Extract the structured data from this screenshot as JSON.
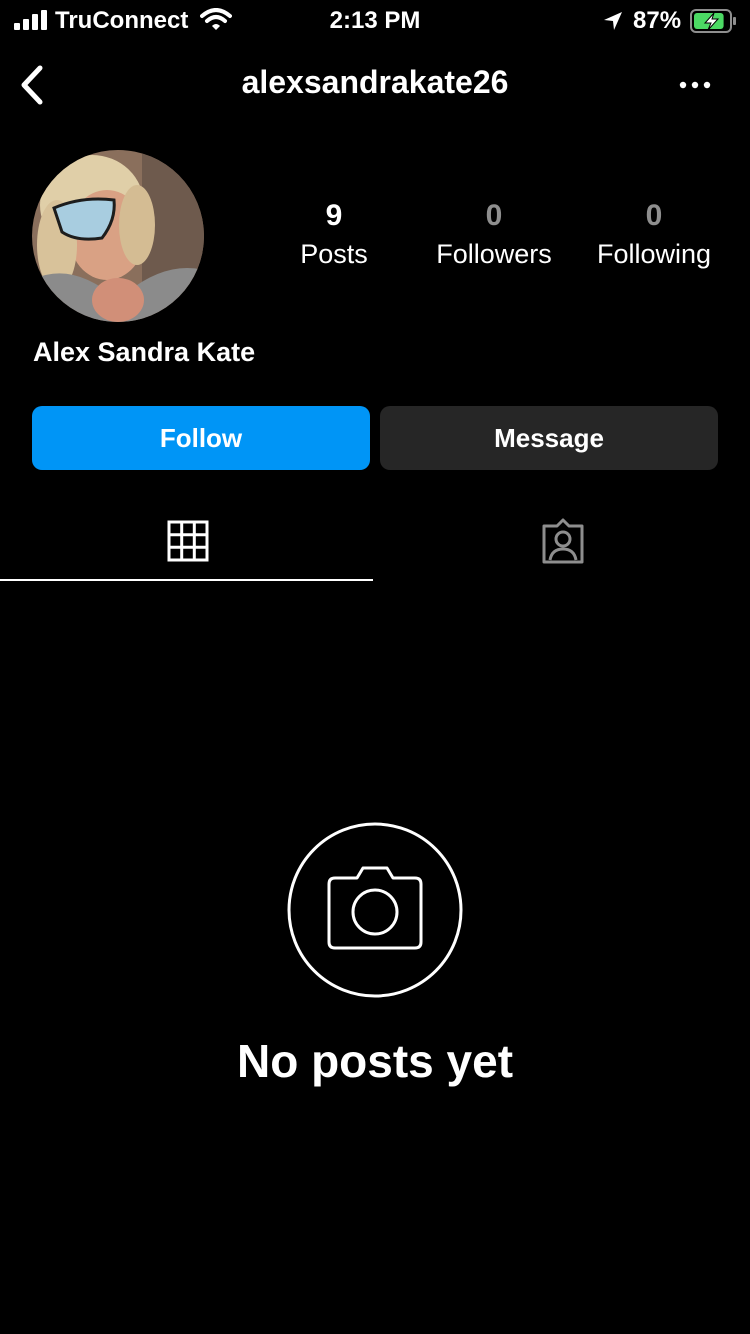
{
  "status_bar": {
    "carrier": "TruConnect",
    "time": "2:13 PM",
    "battery_percent": "87%",
    "battery_level": 0.87,
    "icons": [
      "signal-icon",
      "wifi-icon",
      "location-arrow-icon",
      "battery-charging-icon"
    ]
  },
  "header": {
    "username": "alexsandrakate26",
    "icons": [
      "back-chevron-icon",
      "more-options-icon"
    ]
  },
  "profile": {
    "display_name": "Alex Sandra Kate",
    "stats": {
      "posts": {
        "value": "9",
        "label": "Posts"
      },
      "followers": {
        "value": "0",
        "label": "Followers"
      },
      "following": {
        "value": "0",
        "label": "Following"
      }
    }
  },
  "actions": {
    "follow_label": "Follow",
    "message_label": "Message"
  },
  "tabs": [
    {
      "icon": "grid-icon",
      "selected": true
    },
    {
      "icon": "tagged-person-icon",
      "selected": false
    }
  ],
  "empty_state": {
    "icon": "camera-icon",
    "title": "No posts yet"
  },
  "colors": {
    "background": "#000000",
    "follow_button": "#0095f6",
    "message_button": "#262626",
    "muted_text": "#8e8e8e",
    "battery_green": "#4cd964"
  }
}
